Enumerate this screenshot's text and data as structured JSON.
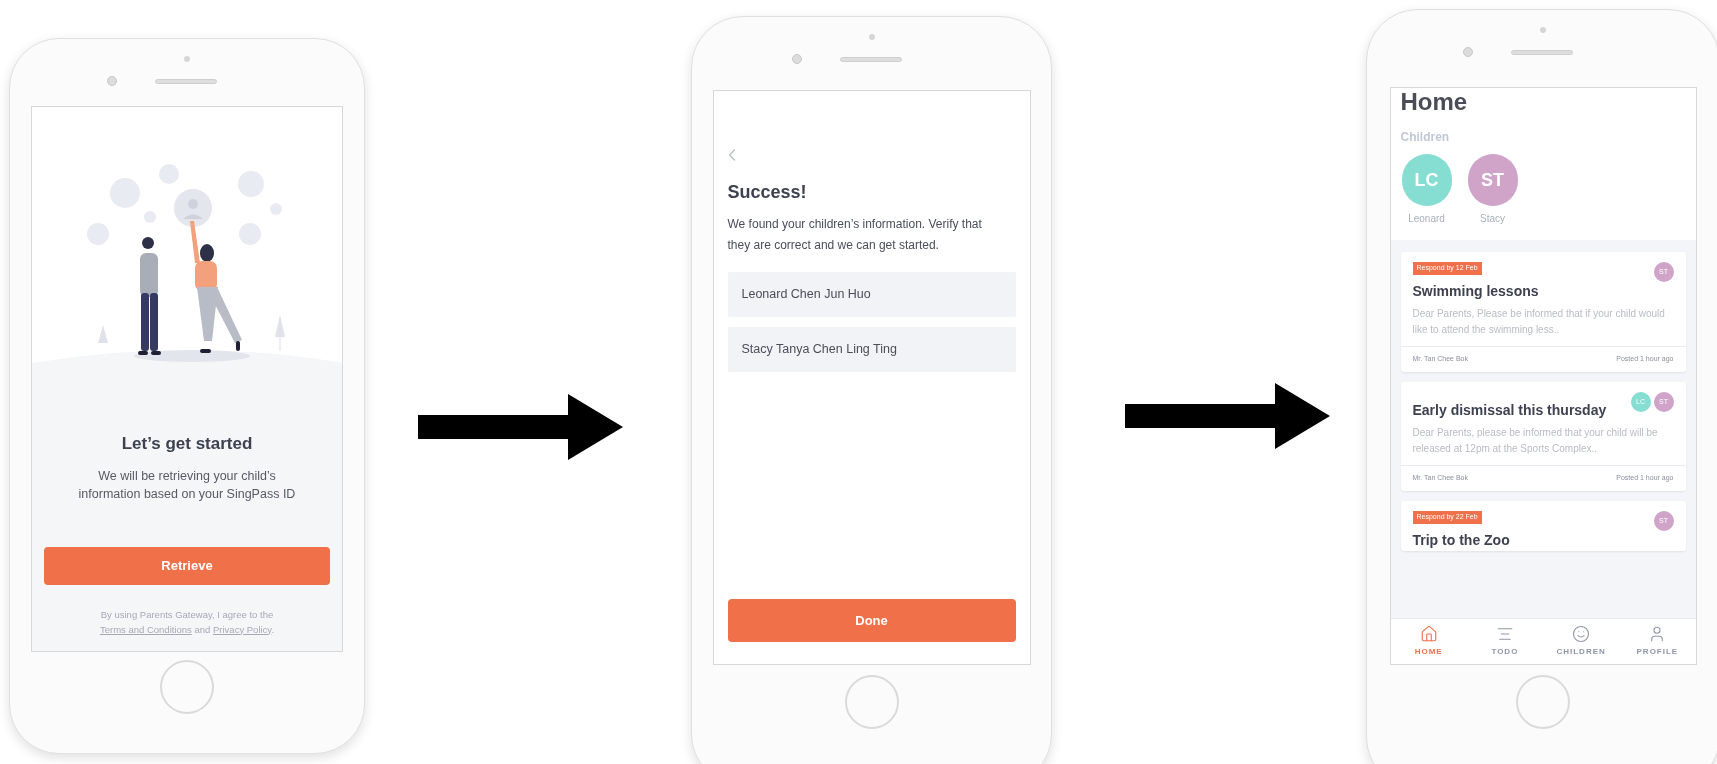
{
  "screens": [
    {
      "kind": "onboarding",
      "title": "Let’s get started",
      "description": "We will be retrieving your child’s information based on your SingPass ID",
      "button": "Retrieve",
      "consent": {
        "before": "By using Parents Gateway, I agree to the",
        "terms_link": "Terms and Conditions",
        "middle": "and",
        "privacy_link": "Privacy Policy",
        "after": "."
      }
    },
    {
      "kind": "confirm",
      "title": "Success!",
      "description": "We found your children’s information. Verify that they are correct and we can get started.",
      "children": [
        "Leonard Chen Jun Huo",
        "Stacy Tanya Chen Ling Ting"
      ],
      "button": "Done"
    },
    {
      "kind": "home",
      "title": "Home",
      "section": "Children",
      "children": [
        {
          "initials": "LC",
          "name": "Leonard",
          "color": "#86ddd1"
        },
        {
          "initials": "ST",
          "name": "Stacy",
          "color": "#d0a3c8"
        }
      ],
      "posts": [
        {
          "badge": "Respond by 12 Feb",
          "title": "Swimming lessons",
          "excerpt": "Dear Parents, Please be informed that if your child would like to attend the swimming less..",
          "author": "Mr. Tan Chee Bok",
          "posted": "Posted 1 hour ago",
          "tags": [
            {
              "initials": "ST",
              "color": "#d0a3c8"
            }
          ]
        },
        {
          "title": "Early dismissal this thursday",
          "excerpt": "Dear Parents, please be informed that your child will be released at 12pm at the Sports Complex..",
          "author": "Mr. Tan Chee Bok",
          "posted": "Posted 1 hour ago",
          "tags": [
            {
              "initials": "LC",
              "color": "#86ddd1"
            },
            {
              "initials": "ST",
              "color": "#d0a3c8"
            }
          ]
        },
        {
          "badge": "Respond by 22 Feb",
          "title": "Trip to the Zoo",
          "tags": [
            {
              "initials": "ST",
              "color": "#d0a3c8"
            }
          ]
        }
      ],
      "tab_bar": [
        {
          "label": "HOME",
          "selected": true
        },
        {
          "label": "TODO",
          "selected": false
        },
        {
          "label": "CHILDREN",
          "selected": false
        },
        {
          "label": "PROFILE",
          "selected": false
        }
      ]
    }
  ]
}
